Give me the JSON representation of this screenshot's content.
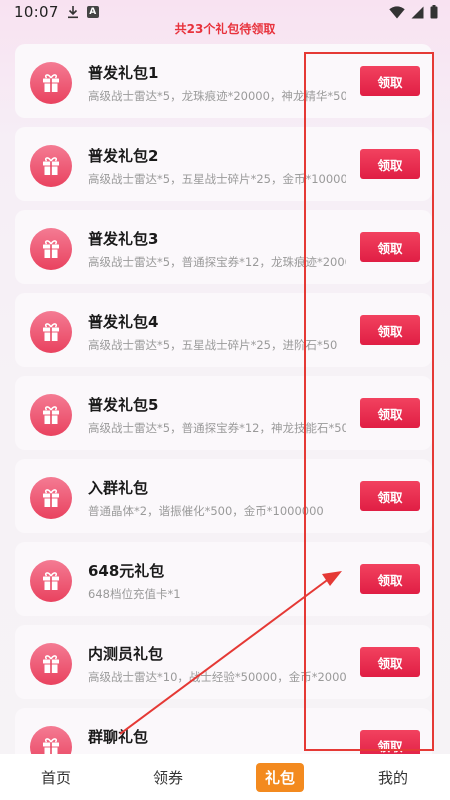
{
  "status_bar": {
    "time": "10:07",
    "icons": [
      "download-icon",
      "text-badge-icon",
      "wifi-icon",
      "signal-icon",
      "battery-icon"
    ],
    "badge_letter": "A"
  },
  "summary": "共23个礼包待领取",
  "claim_label": "领取",
  "gifts": [
    {
      "title": "普发礼包1",
      "desc": "高级战士雷达*5，龙珠痕迹*20000，神龙精华*50"
    },
    {
      "title": "普发礼包2",
      "desc": "高级战士雷达*5，五星战士碎片*25，金币*1000000"
    },
    {
      "title": "普发礼包3",
      "desc": "高级战士雷达*5，普通探宝券*12，龙珠痕迹*20000"
    },
    {
      "title": "普发礼包4",
      "desc": "高级战士雷达*5，五星战士碎片*25，进阶石*50"
    },
    {
      "title": "普发礼包5",
      "desc": "高级战士雷达*5，普通探宝券*12，神龙技能石*50"
    },
    {
      "title": "入群礼包",
      "desc": "普通晶体*2，谐振催化*500，金币*1000000"
    },
    {
      "title": "648元礼包",
      "desc": "648档位充值卡*1"
    },
    {
      "title": "内测员礼包",
      "desc": "高级战士雷达*10，战士经验*50000，金币*2000000"
    },
    {
      "title": "群聊礼包",
      "desc": ""
    }
  ],
  "tabs": [
    {
      "label": "首页",
      "active": false
    },
    {
      "label": "领券",
      "active": false
    },
    {
      "label": "礼包",
      "active": true
    },
    {
      "label": "我的",
      "active": false
    }
  ],
  "colors": {
    "accent_red": "#e8323c",
    "button_red": "#e01e44",
    "gift_icon_pink": "#ee5a74",
    "active_tab_orange": "#f38a1f",
    "annotation_red": "#e53935"
  }
}
